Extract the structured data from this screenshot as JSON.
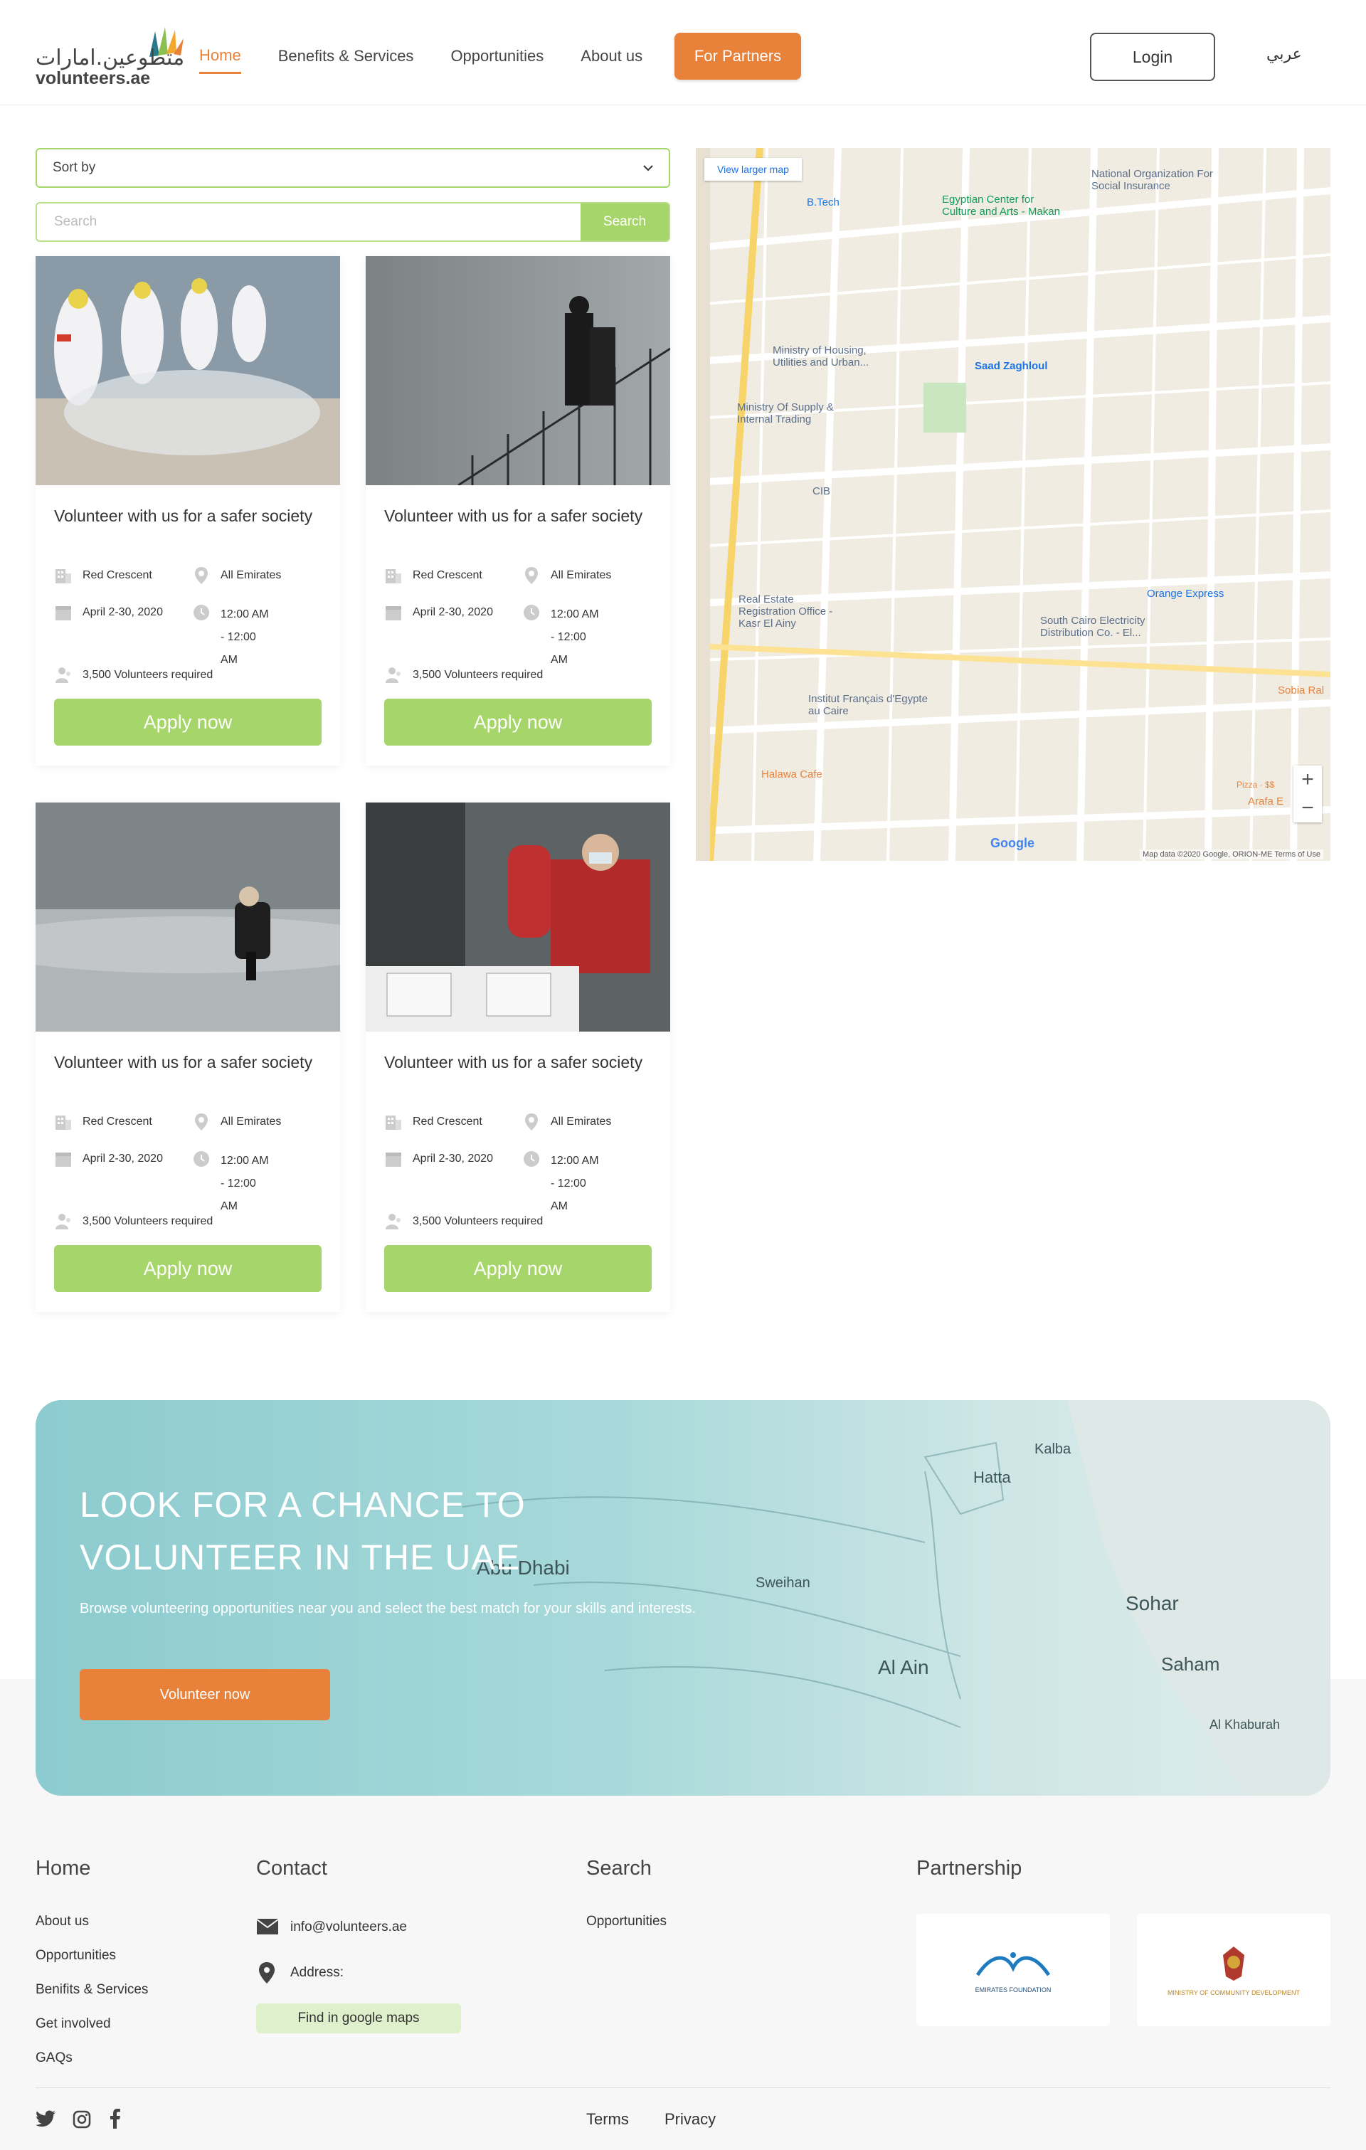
{
  "header": {
    "logo_ar": "متطوعين.امارات",
    "logo_en": "volunteers.ae",
    "nav": [
      {
        "label": "Home",
        "active": true
      },
      {
        "label": "Benefits & Services",
        "active": false
      },
      {
        "label": "Opportunities",
        "active": false
      },
      {
        "label": "About us",
        "active": false
      }
    ],
    "partners_label": "For Partners",
    "login_label": "Login",
    "lang_label": "عربي"
  },
  "filters": {
    "sort_label": "Sort by",
    "search_placeholder": "Search",
    "search_button": "Search"
  },
  "cards": [
    {
      "title": "Volunteer with us for a safer society",
      "org": "Red Crescent",
      "location": "All Emirates",
      "date": "April 2-30, 2020",
      "time": "12:00 AM - 12:00 AM",
      "volunteers": "3,500 Volunteers required",
      "apply": "Apply now"
    },
    {
      "title": "Volunteer with us for a safer society",
      "org": "Red Crescent",
      "location": "All Emirates",
      "date": "April 2-30, 2020",
      "time": "12:00 AM - 12:00 AM",
      "volunteers": "3,500 Volunteers required",
      "apply": "Apply now"
    },
    {
      "title": "Volunteer with us for a safer society",
      "org": "Red Crescent",
      "location": "All Emirates",
      "date": "April 2-30, 2020",
      "time": "12:00 AM - 12:00 AM",
      "volunteers": "3,500 Volunteers required",
      "apply": "Apply now"
    },
    {
      "title": "Volunteer with us for a safer society",
      "org": "Red Crescent",
      "location": "All Emirates",
      "date": "April 2-30, 2020",
      "time": "12:00 AM - 12:00 AM",
      "volunteers": "3,500 Volunteers required",
      "apply": "Apply now"
    }
  ],
  "map": {
    "larger_map": "View larger map",
    "labels": [
      "B.Tech",
      "Egyptian Center for Culture and Arts - Makan",
      "National Organization For Social Insurance",
      "Ministry of Housing, Utilities and Urban...",
      "Ministry Of Supply & Internal Trading",
      "Saad Zaghloul",
      "CIB",
      "Real Estate Registration Office - Kasr El Ainy",
      "South Cairo Electricity Distribution Co. - El...",
      "Orange Express",
      "Institut Français d'Egypte au Caire",
      "Halawa Cafe",
      "Sobia Ral",
      "Arafa E",
      "Pizza · $$"
    ],
    "zoom_in": "+",
    "zoom_out": "−",
    "google": "Google",
    "footer": "Map data ©2020 Google, ORION-ME   Terms of Use"
  },
  "banner": {
    "title_line1": "LOOK FOR A CHANCE TO",
    "title_line2": "VOLUNTEER IN THE UAE",
    "text": "Browse volunteering opportunities near you and select the best match for your skills and interests.",
    "button": "Volunteer now",
    "places": [
      "Abu Dhabi",
      "Hatta",
      "Kalba",
      "Sweihan",
      "Al Ain",
      "Sohar",
      "Saham",
      "Al Khaburah"
    ]
  },
  "footer": {
    "home_heading": "Home",
    "home_links": [
      "About us",
      "Opportunities",
      "Benifits & Services",
      "Get involved",
      "GAQs"
    ],
    "contact_heading": "Contact",
    "email": "info@volunteers.ae",
    "address_label": "Address:",
    "maps_button": "Find in google maps",
    "search_heading": "Search",
    "search_links": [
      "Opportunities"
    ],
    "partnership_heading": "Partnership",
    "partner1": "EMIRATES FOUNDATION",
    "partner2": "MINISTRY OF COMMUNITY DEVELOPMENT",
    "terms": "Terms",
    "privacy": "Privacy"
  }
}
